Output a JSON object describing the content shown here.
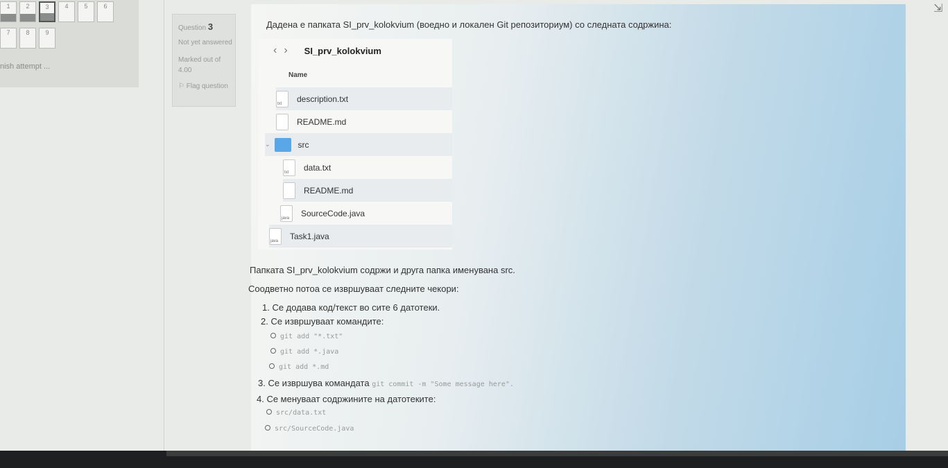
{
  "quiz_nav": {
    "row1": [
      "1",
      "2",
      "3",
      "4",
      "5",
      "6"
    ],
    "row2": [
      "7",
      "8",
      "9"
    ],
    "finish_label": "nish attempt ..."
  },
  "question_info": {
    "question_label": "Question",
    "question_number": "3",
    "status": "Not yet answered",
    "marked": "Marked out of 4.00",
    "flag": "Flag question"
  },
  "question": {
    "intro": "Дадена е папката SI_prv_kolokvium (воедно и локален Git репозиториум) со следната содржина:",
    "explorer": {
      "path": "SI_prv_kolokvium",
      "column": "Name",
      "items": [
        {
          "name": "description.txt",
          "icon": "txt"
        },
        {
          "name": "README.md",
          "icon": ""
        },
        {
          "name": "src",
          "icon": "folder"
        },
        {
          "name": "data.txt",
          "icon": "txt"
        },
        {
          "name": "README.md",
          "icon": ""
        },
        {
          "name": "SourceCode.java",
          "icon": "java"
        },
        {
          "name": "Task1.java",
          "icon": "java"
        }
      ]
    },
    "p1": "Папката SI_prv_kolokvium содржи и друга папка именувана src.",
    "p2": "Соодветно потоа се извршуваат следните чекори:",
    "step1": "1. Се додава код/текст во сите 6 датотеки.",
    "step2": "2. Се извршуваат командите:",
    "cmd1": "git add \"*.txt\"",
    "cmd2": "git add *.java",
    "cmd3": "git add *.md",
    "step3": "3. Се извршува командата",
    "step3_code": "git commit -m \"Some message here\".",
    "step4": "4. Се менуваат содржините на датотеките:",
    "file1": "src/data.txt",
    "file2": "src/SourceCode.java"
  }
}
